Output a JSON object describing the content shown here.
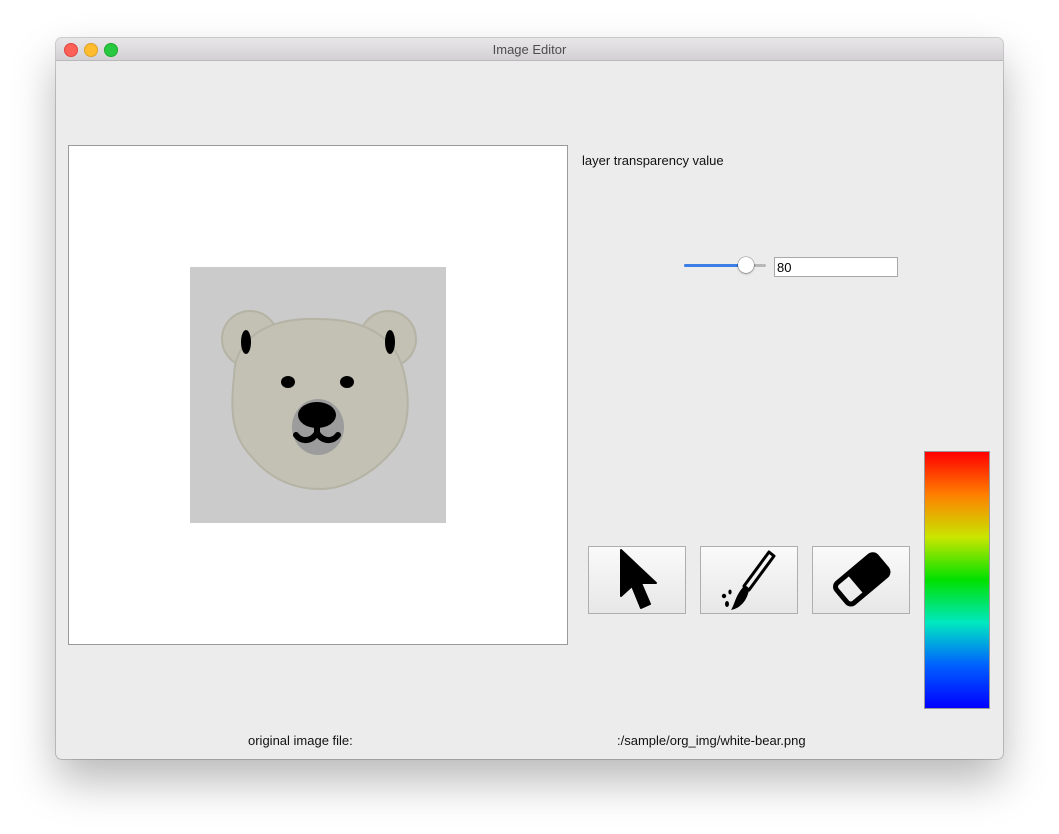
{
  "window": {
    "title": "Image Editor"
  },
  "canvas": {
    "image_name": "white-bear"
  },
  "transparency": {
    "label": "layer transparency value",
    "value": "80",
    "slider_fraction": 0.8
  },
  "tools": [
    {
      "name": "pointer",
      "icon": "arrow-cursor-icon"
    },
    {
      "name": "brush",
      "icon": "paintbrush-icon"
    },
    {
      "name": "eraser",
      "icon": "eraser-icon"
    }
  ],
  "color_picker": {
    "gradient_stops": [
      "#ff0000",
      "#ff7f00",
      "#c8e600",
      "#00e000",
      "#00e8c0",
      "#0060ff",
      "#0000ff"
    ]
  },
  "footer": {
    "original_label": "original image file:",
    "original_path": ":/sample/org_img/white-bear.png"
  }
}
